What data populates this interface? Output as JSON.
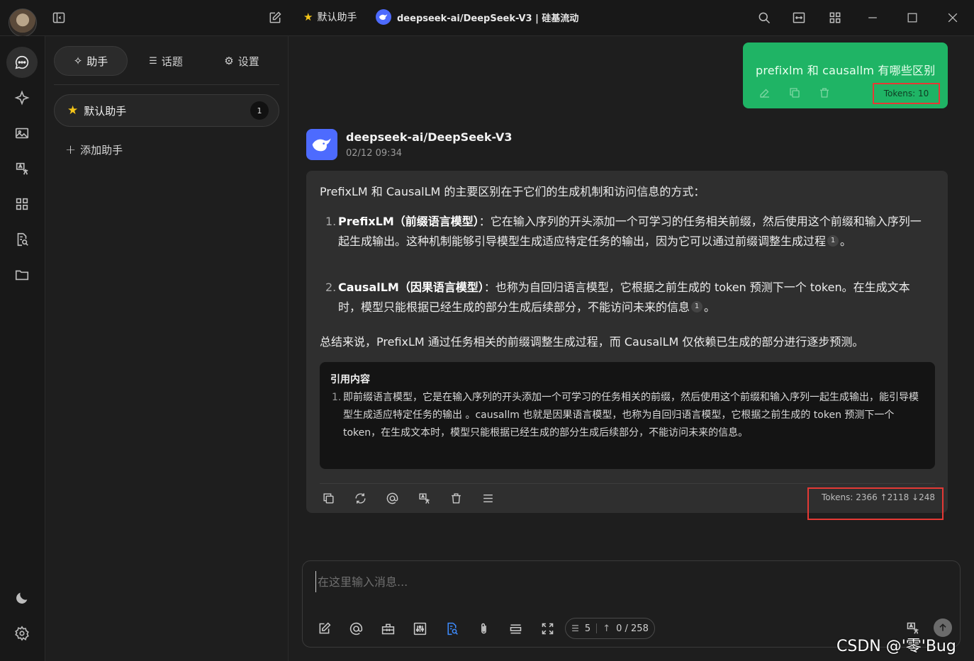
{
  "titlebar": {
    "assistant": "默认助手",
    "model": "deepseek-ai/DeepSeek-V3 | 硅基流动"
  },
  "sidebar": {
    "tabs": [
      {
        "label": "助手",
        "icon": "sparkle-icon"
      },
      {
        "label": "话题",
        "icon": "list-icon"
      },
      {
        "label": "设置",
        "icon": "gear-icon"
      }
    ],
    "assistant_item": {
      "name": "默认助手",
      "count": "1"
    },
    "add_label": "添加助手"
  },
  "chat": {
    "user_message": {
      "text": "prefixlm 和 causallm 有哪些区别",
      "tokens": "Tokens: 10"
    },
    "bot_message": {
      "model": "deepseek-ai/DeepSeek-V3",
      "time": "02/12 09:34",
      "intro": "PrefixLM 和 CausalLM 的主要区别在于它们的生成机制和访问信息的方式：",
      "items": [
        {
          "num": "1.",
          "title": "PrefixLM（前缀语言模型）",
          "text": "：它在输入序列的开头添加一个可学习的任务相关前缀，然后使用这个前缀和输入序列一起生成输出。这种机制能够引导模型生成适应特定任务的输出，因为它可以通过前缀调整生成过程",
          "cite": "1",
          "end": "。"
        },
        {
          "num": "2.",
          "title": "CausalLM（因果语言模型）",
          "text": "：也称为自回归语言模型，它根据之前生成的 token 预测下一个 token。在生成文本时，模型只能根据已经生成的部分生成后续部分，不能访问未来的信息",
          "cite": "1",
          "end": "。"
        }
      ],
      "summary": "总结来说，PrefixLM 通过任务相关的前缀调整生成过程，而 CausalLM 仅依赖已生成的部分进行逐步预测。",
      "reference": {
        "title": "引用内容",
        "num": "1.",
        "text": "即前缀语言模型，它是在输入序列的开头添加一个可学习的任务相关的前缀，然后使用这个前缀和输入序列一起生成输出，能引导模型生成适应特定任务的输出 。causallm 也就是因果语言模型，也称为自回归语言模型，它根据之前生成的 token 预测下一个 token，在生成文本时，模型只能根据已经生成的部分生成后续部分，不能访问未来的信息。"
      },
      "tokens": "Tokens: 2366 ↑2118 ↓248"
    }
  },
  "input": {
    "placeholder": "在这里输入消息...",
    "context_count": "5",
    "token_count": "0 / 258"
  },
  "watermark": "CSDN @'零'Bug",
  "colors": {
    "user_bubble": "#1fb465",
    "highlight_box": "#e53935",
    "accent_blue": "#3d8bfd",
    "deepseek_blue": "#4d6bfe"
  }
}
